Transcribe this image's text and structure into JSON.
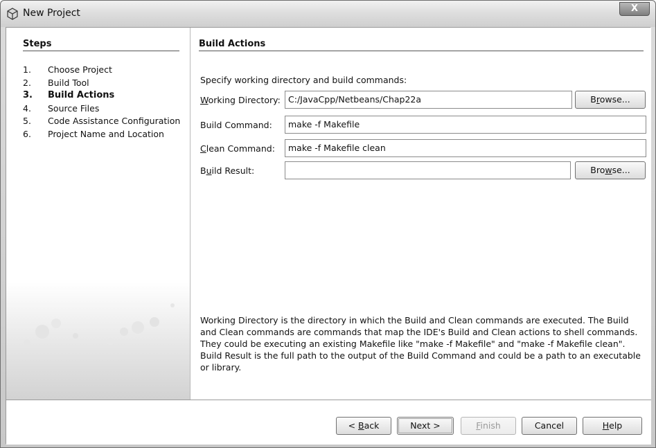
{
  "window": {
    "title": "New Project",
    "close_glyph": "X"
  },
  "steps": {
    "header": "Steps",
    "items": [
      {
        "num": "1.",
        "label": "Choose Project"
      },
      {
        "num": "2.",
        "label": "Build Tool"
      },
      {
        "num": "3.",
        "label": "Build Actions"
      },
      {
        "num": "4.",
        "label": "Source Files"
      },
      {
        "num": "5.",
        "label": "Code Assistance Configuration"
      },
      {
        "num": "6.",
        "label": "Project Name and Location"
      }
    ],
    "current_index": 2
  },
  "main": {
    "header": "Build Actions",
    "instruction": "Specify working directory and build commands:",
    "fields": {
      "working_directory": {
        "label_mnemonic": "W",
        "label_rest": "orking Directory:",
        "value": "C:/JavaCpp/Netbeans/Chap22a"
      },
      "build_command": {
        "label": "Build Command:",
        "value": "make -f Makefile"
      },
      "clean_command": {
        "label_mnemonic": "C",
        "label_rest": "lean Command:",
        "value": "make -f Makefile clean"
      },
      "build_result": {
        "label_pre": "B",
        "label_mnemonic": "u",
        "label_rest": "ild Result:",
        "value": ""
      }
    },
    "browse_working": {
      "pre": "B",
      "mnemonic": "r",
      "rest": "owse..."
    },
    "browse_result": {
      "pre": "Bro",
      "mnemonic": "w",
      "rest": "se..."
    },
    "description": "Working Directory is the directory in which the Build and Clean commands are executed. The Build and Clean commands are commands that map the IDE's Build and Clean actions to shell commands. They could be executing an existing Makefile like \"make -f Makefile\" and \"make -f Makefile clean\". Build Result is the full path to the output of the Build Command and could be a path to an executable or library."
  },
  "footer": {
    "back": {
      "pre": "< ",
      "mnemonic": "B",
      "rest": "ack"
    },
    "next": "Next >",
    "finish": {
      "mnemonic": "F",
      "rest": "inish"
    },
    "cancel": "Cancel",
    "help": {
      "mnemonic": "H",
      "rest": "elp"
    }
  },
  "icons": {
    "title": "netbeans-cube-icon",
    "close": "close-icon"
  },
  "colors": {
    "titlebar": "#dedede",
    "border": "#6d6d6d",
    "disabled_text": "#999999"
  }
}
